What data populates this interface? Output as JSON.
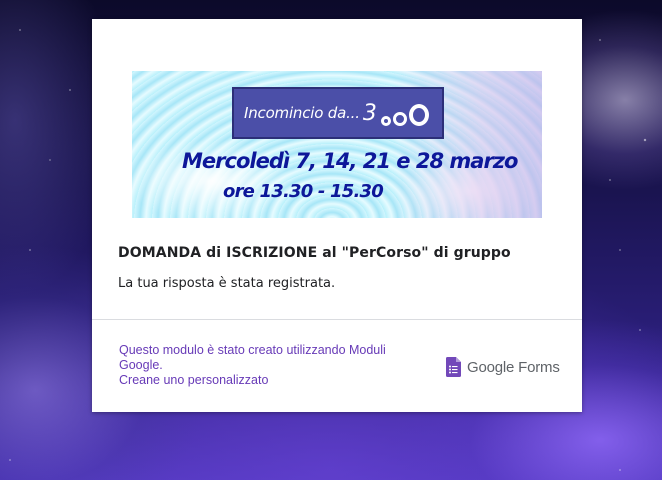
{
  "banner": {
    "title": "Incomincio da...",
    "number": "3",
    "dates": "Mercoledì 7, 14, 21 e 28 marzo",
    "hours": "ore 13.30 - 15.30"
  },
  "form": {
    "title": "DOMANDA di ISCRIZIONE al \"PerCorso\" di gruppo",
    "response_message": "La tua risposta è stata registrata."
  },
  "footer": {
    "notice_line1": "Questo modulo è stato creato utilizzando Moduli",
    "notice_line2": "Google.",
    "create_link": "Creane uno personalizzato",
    "brand": "Google Forms",
    "brand_icon": "google-forms-icon"
  },
  "colors": {
    "accent": "#673ab7",
    "banner_title_bg": "#4b4fa8",
    "banner_text": "#0d1799"
  }
}
